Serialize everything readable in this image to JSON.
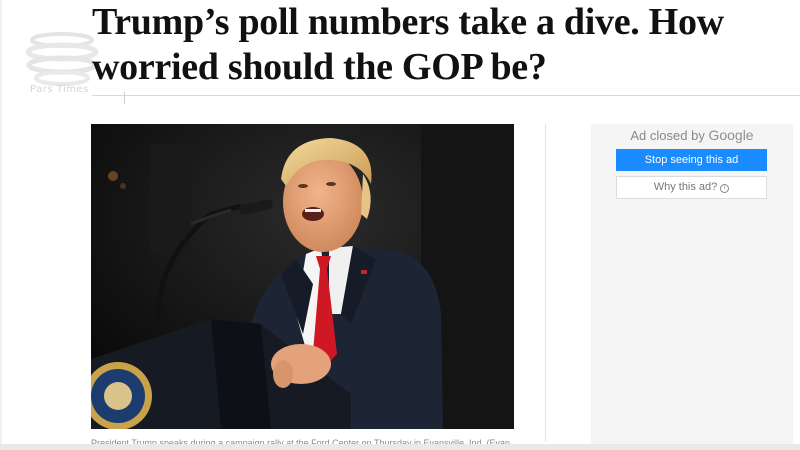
{
  "article": {
    "headline_line1": "Trump’s poll numbers take a dive. How",
    "headline_line2": "worried should the GOP be?",
    "caption": "President Trump speaks during a campaign rally at the Ford Center on Thursday in Evansville, Ind. (Evan"
  },
  "watermark": {
    "text": "Pars Times",
    "icon": "globe-logo-icon"
  },
  "photo": {
    "description_icon": "article-photo",
    "podium_seal_icon": "presidential-seal-icon"
  },
  "ad": {
    "closed_prefix": "Ad closed by",
    "closed_brand": "Google",
    "stop_label": "Stop seeing this ad",
    "why_label": "Why this ad?",
    "why_icon": "info-icon",
    "stop_color": "#1a8cff"
  }
}
